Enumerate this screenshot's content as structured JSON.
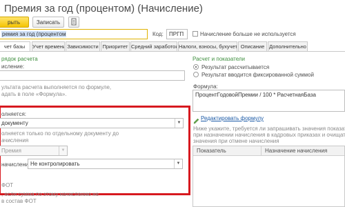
{
  "window": {
    "title": "Премия за год (процентом) (Начисление)"
  },
  "toolbar": {
    "save_close_label": "рыть",
    "save_label": "Записать"
  },
  "header": {
    "name_value": "ремия за год (процентом",
    "code_label": "Код:",
    "code_value": "ПРГП",
    "no_longer_used_label": "Начисление больше не используется"
  },
  "tabs": [
    {
      "label": "чет базы"
    },
    {
      "label": "Учет времени"
    },
    {
      "label": "Зависимости"
    },
    {
      "label": "Приоритет"
    },
    {
      "label": "Средний заработок"
    },
    {
      "label": "Налоги, взносы, бухучет"
    },
    {
      "label": "Описание"
    },
    {
      "label": "Дополнительно"
    }
  ],
  "left": {
    "section_title": "рядок расчета",
    "calc_label": "ислениe:",
    "calc_hint_line1": "ультата расчета выполняется по формуле,",
    "calc_hint_line2": "адать в поле «Формула».",
    "executes_label": "олняется:",
    "executes_value": "документу",
    "executes_hint_line1": "олняется только по отдельному документу до",
    "executes_hint_line2": "ачисления",
    "premium_value": "Премия",
    "accrual_label": "начисления:",
    "accrual_value": "Не контролировать",
    "fot_label": "ФОТ",
    "fot_hint_line1": ", если сумма по этому начислению не",
    "fot_hint_line2": "в состав ФОТ"
  },
  "right": {
    "section_title": "Расчет и показатели",
    "radio_calculated": "Результат рассчитывается",
    "radio_fixed": "Результат вводится фиксированной суммой",
    "formula_label": "Формула:",
    "formula_value": "ПроцентГодовойПремии / 100 * РасчетнаяБаза",
    "edit_formula_link": "Редактировать формулу",
    "indicators_hint_line1": "Ниже укажите, требуется ли запрашивать значения показателей",
    "indicators_hint_line2": "при назначении начисления в кадровых приказах и очищать",
    "indicators_hint_line3": "значения при отмене начисления",
    "col_indicator": "Показатель",
    "col_purpose": "Назначение начисления"
  },
  "colors": {
    "accent_yellow": "#f5c400",
    "highlight_red": "#d7191f",
    "link_green": "#3f8f3f",
    "selection_blue": "#cfe0f7"
  }
}
